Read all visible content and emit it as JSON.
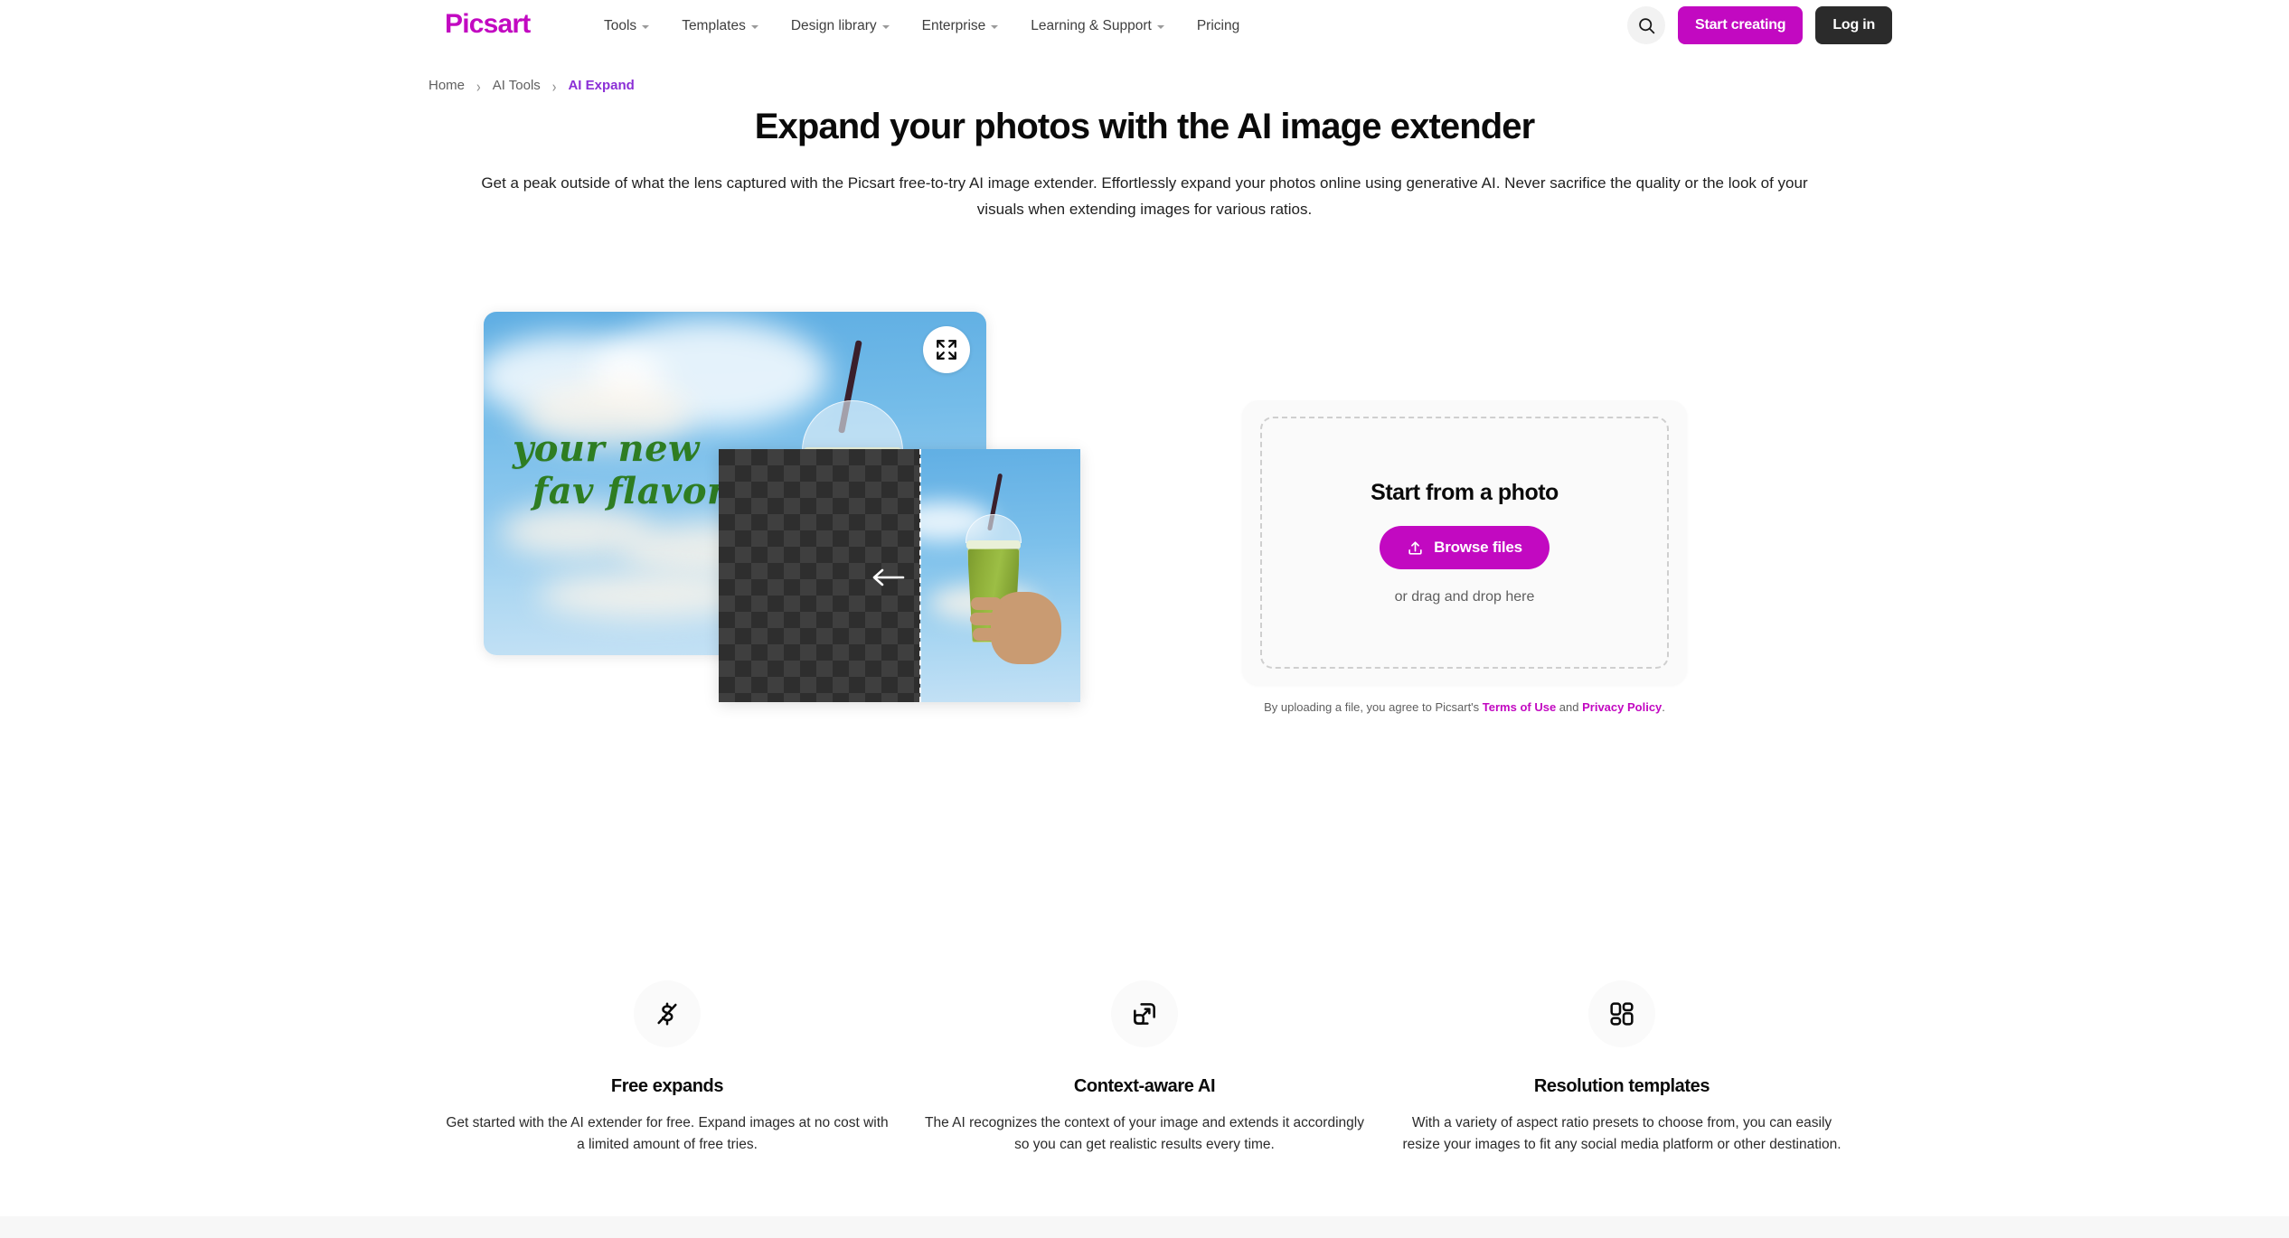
{
  "header": {
    "logo_text": "Picsart",
    "nav_items": [
      {
        "label": "Tools",
        "has_dropdown": true
      },
      {
        "label": "Templates",
        "has_dropdown": true
      },
      {
        "label": "Design library",
        "has_dropdown": true
      },
      {
        "label": "Enterprise",
        "has_dropdown": true
      },
      {
        "label": "Learning & Support",
        "has_dropdown": true
      },
      {
        "label": "Pricing",
        "has_dropdown": false
      }
    ],
    "search_icon": "search-icon",
    "start_creating_label": "Start creating",
    "login_label": "Log in",
    "brand_color": "#C209C1",
    "login_bg_color": "#2B2B2B"
  },
  "breadcrumb": {
    "items": [
      {
        "label": "Home",
        "current": false
      },
      {
        "label": "AI Tools",
        "current": false
      },
      {
        "label": "AI Expand",
        "current": true
      }
    ],
    "separator": "›",
    "current_color": "#8B2FD6"
  },
  "hero": {
    "title": "Expand your photos with the AI image extender",
    "subtitle": "Get a peak outside of what the lens captured with the Picsart free-to-try AI image extender. Effortlessly expand your photos online using generative AI. Never sacrifice the quality or the look of your visuals when extending images for various ratios."
  },
  "preview": {
    "overlay_text_line1": "your new",
    "overlay_text_line2": "fav flavor",
    "overlay_text_color": "#2E7D22",
    "expand_icon": "expand-arrows-icon",
    "direction_arrow_icon": "arrow-left-icon",
    "sky_color": "#74BCE9",
    "drink_color": "#9CBE45"
  },
  "upload": {
    "title": "Start from a photo",
    "browse_label": "Browse files",
    "browse_icon": "upload-icon",
    "drag_text": "or drag and drop here",
    "button_color": "#C209C1",
    "disclaimer_prefix": "By uploading a file, you agree to Picsart's ",
    "terms_label": "Terms of Use",
    "disclaimer_mid": " and ",
    "privacy_label": "Privacy Policy",
    "disclaimer_suffix": "."
  },
  "features": [
    {
      "icon": "dollar-slash-icon",
      "title": "Free expands",
      "description": "Get started with the AI extender for free. Expand images at no cost with a limited amount of free tries."
    },
    {
      "icon": "resize-expand-icon",
      "title": "Context-aware AI",
      "description": "The AI recognizes the context of your image and extends it accordingly so you can get realistic results every time."
    },
    {
      "icon": "grid-templates-icon",
      "title": "Resolution templates",
      "description": "With a variety of aspect ratio presets to choose from, you can easily resize your images to fit any social media platform or other destination."
    }
  ]
}
